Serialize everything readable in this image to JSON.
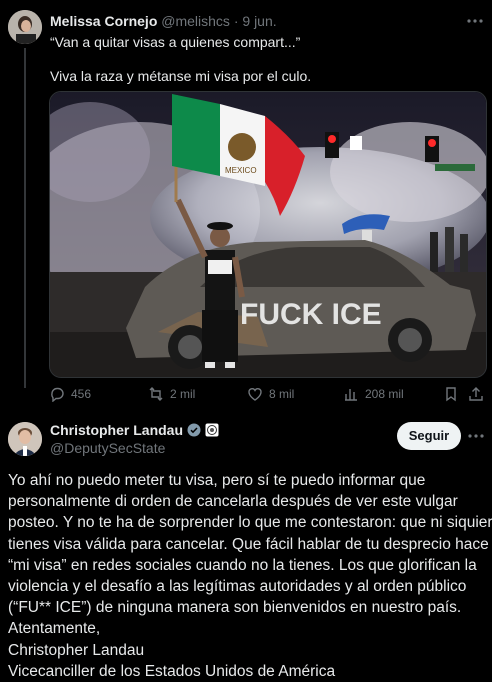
{
  "reply_tweet": {
    "author_name": "Melissa Cornejo",
    "author_handle": "@melishcs",
    "separator": "·",
    "date": "9 jun.",
    "quote_line": "“Van a quitar visas a quienes compart...”",
    "body": "Viva la raza y métanse mi visa por el culo.",
    "image": {
      "flag_text": "MEXICO",
      "car_graffiti": "FUCK ICE"
    },
    "actions": {
      "replies": "456",
      "reposts": "2 mil",
      "likes": "8 mil",
      "views": "208 mil"
    }
  },
  "main_tweet": {
    "author_name": "Christopher Landau",
    "author_handle": "@DeputySecState",
    "follow_label": "Seguir",
    "lines": [
      "Yo ahí no puedo meter tu visa, pero sí te puedo informar que",
      "personalmente di orden de cancelarla después de ver este vulgar",
      "posteo. Y no te ha de sorprender lo que me contestaron: que ni siquiera",
      "tienes visa válida para cancelar. Que fácil hablar de tu desprecio hace",
      "“mi visa” en redes sociales cuando no la tienes. Los que glorifican la",
      "violencia y el desafío a las legítimas autoridades y al orden público",
      "(“FU** ICE”) de ninguna manera son bienvenidos en nuestro país.",
      "Atentamente,",
      "Christopher Landau",
      "Vicecanciller de los Estados Unidos de América"
    ]
  },
  "colors": {
    "background": "#000000",
    "text": "#e7e9ea",
    "muted": "#71767b",
    "verified": "#829aab",
    "follow_bg": "#eff3f4"
  }
}
